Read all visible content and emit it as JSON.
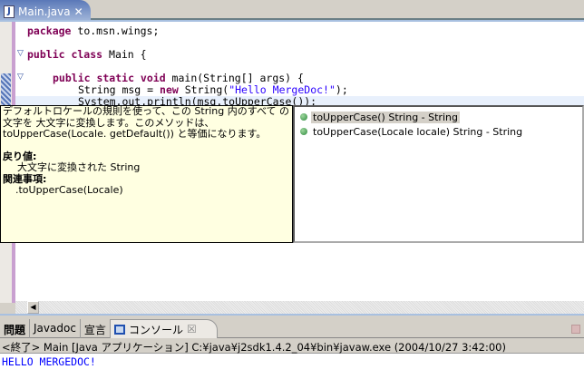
{
  "editor_tab": {
    "title": "Main.java",
    "icon": "java-file-icon"
  },
  "code": {
    "l1": {
      "kw": "package",
      "rest": " to.msn.wings;"
    },
    "l3": {
      "kw": "public class",
      "rest": " Main {"
    },
    "l5": {
      "kw": "public static void",
      "rest": " main(String[] args) {"
    },
    "l6": {
      "a": "String msg = ",
      "kw": "new",
      "b": " String(",
      "str": "\"Hello MergeDoc!\"",
      "c": ");"
    },
    "l7": "System.out.println(msg.toUpperCase());"
  },
  "javadoc": {
    "desc": "デフォルトロケールの規則を使って、この String 内のすべて の文字を 大文字に変換します。このメソッドは、toUpperCase(Locale. getDefault()) と等価になります。",
    "returns_label": "戻り値:",
    "returns": "大文字に変換された String",
    "see_label": "関連事項:",
    "see": ".toUpperCase(Locale)"
  },
  "proposals": [
    {
      "label": "toUpperCase()  String - String",
      "selected": true
    },
    {
      "label": "toUpperCase(Locale locale)  String - String",
      "selected": false
    }
  ],
  "view_tabs": [
    {
      "label": "問題"
    },
    {
      "label": "Javadoc"
    },
    {
      "label": "宣言"
    },
    {
      "label": "コンソール",
      "active": true
    }
  ],
  "console": {
    "header": "<終了> Main [Java アプリケーション] C:¥java¥j2sdk1.4.2_04¥bin¥javaw.exe (2004/10/27 3:42:00)",
    "output": "HELLO MERGEDOC!"
  }
}
